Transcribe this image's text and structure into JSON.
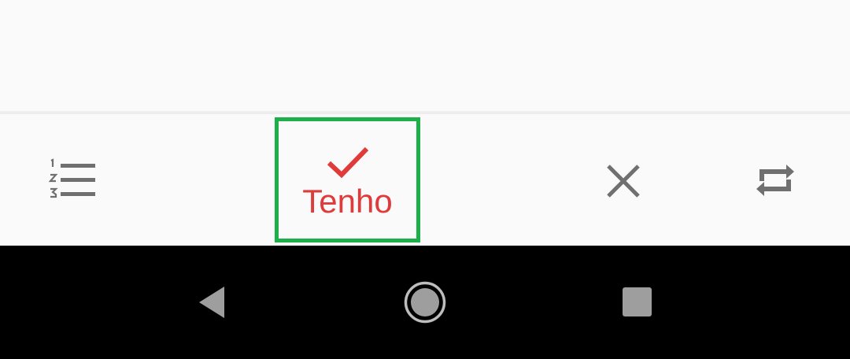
{
  "toolbar": {
    "list_icon": "numbered-list-icon",
    "have_button": {
      "label": "Tenho",
      "icon": "checkmark-icon",
      "color": "#e03a3a",
      "highlight_color": "#1db04a"
    },
    "close_icon": "close-icon",
    "swap_icon": "repeat-icon",
    "icon_color": "#707070"
  },
  "system_nav": {
    "back_icon": "back-triangle-icon",
    "home_icon": "home-circle-icon",
    "recents_icon": "recents-square-icon",
    "background": "#000000"
  }
}
